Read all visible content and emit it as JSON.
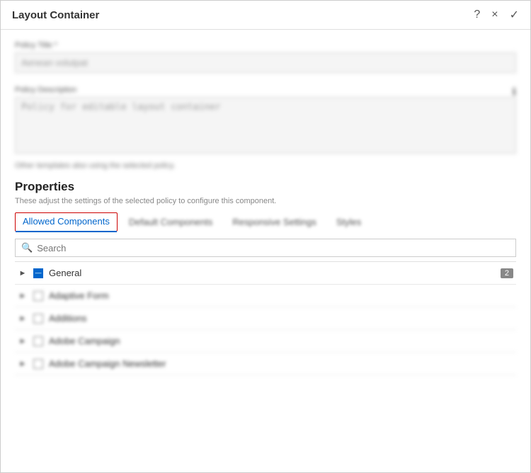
{
  "dialog": {
    "title": "Layout Container"
  },
  "header_icons": {
    "help": "?",
    "close": "×",
    "confirm": "✓"
  },
  "fields": {
    "policy_title_label": "Policy Title *",
    "policy_title_value": "Aenean volutpat",
    "policy_description_label": "Policy Description",
    "policy_description_value": "Policy for editable layout container",
    "helper_text": "Other templates also using the selected policy."
  },
  "properties": {
    "section_title": "Properties",
    "description": "These adjust the settings of the selected policy to configure this component.",
    "tabs": [
      {
        "id": "allowed-components",
        "label": "Allowed Components",
        "active": true
      },
      {
        "id": "default-components",
        "label": "Default Components",
        "active": false
      },
      {
        "id": "responsive-settings",
        "label": "Responsive Settings",
        "active": false
      },
      {
        "id": "styles",
        "label": "Styles",
        "active": false
      }
    ]
  },
  "search": {
    "placeholder": "Search"
  },
  "list": {
    "rows": [
      {
        "id": "row1",
        "label": "General",
        "badge": "2",
        "expanded": true,
        "checkbox_state": "indeterminate"
      },
      {
        "id": "row2",
        "label": "Adaptive Form",
        "badge": null,
        "expanded": false,
        "checkbox_state": "unchecked"
      },
      {
        "id": "row3",
        "label": "Additions",
        "badge": null,
        "expanded": false,
        "checkbox_state": "unchecked"
      },
      {
        "id": "row4",
        "label": "Adobe Campaign",
        "badge": null,
        "expanded": false,
        "checkbox_state": "unchecked"
      },
      {
        "id": "row5",
        "label": "Adobe Campaign Newsletter",
        "badge": null,
        "expanded": false,
        "checkbox_state": "unchecked"
      }
    ]
  }
}
